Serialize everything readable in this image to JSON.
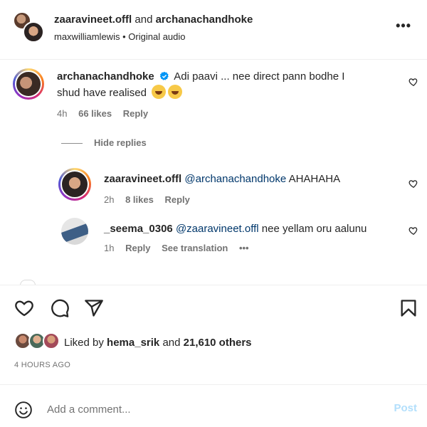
{
  "header": {
    "user1": "zaaravineet.offl",
    "connector": "and",
    "user2": "archanachandhoke",
    "audio_author": "maxwilliamlewis",
    "separator": "•",
    "audio_label": "Original audio",
    "more_label": "•••"
  },
  "comments": [
    {
      "username": "archanachandhoke",
      "verified": true,
      "text_line1": "Adi paavi ... nee direct pann bodhe I",
      "text_line2": "shud have realised",
      "time": "4h",
      "likes": "66 likes",
      "reply": "Reply"
    }
  ],
  "hide_replies_label": "Hide replies",
  "replies": [
    {
      "username": "zaaravineet.offl",
      "mention": "@archanachandhoke",
      "text": "AHAHAHA",
      "time": "2h",
      "likes": "8 likes",
      "reply": "Reply"
    },
    {
      "username": "_seema_0306",
      "mention": "@zaaravineet.offl",
      "text": "nee yellam oru aalunu",
      "time": "1h",
      "reply": "Reply",
      "see_translation": "See translation",
      "more": "•••"
    }
  ],
  "likes": {
    "prefix": "Liked by",
    "user": "hema_srik",
    "connector": "and",
    "others": "21,610 others"
  },
  "timestamp": "4 HOURS AGO",
  "add_comment": {
    "placeholder": "Add a comment...",
    "post_label": "Post"
  },
  "colors": {
    "text": "#262626",
    "secondary": "#737373",
    "mention": "#00376b",
    "verified": "#0095f6",
    "post_disabled": "#b2dffc"
  }
}
